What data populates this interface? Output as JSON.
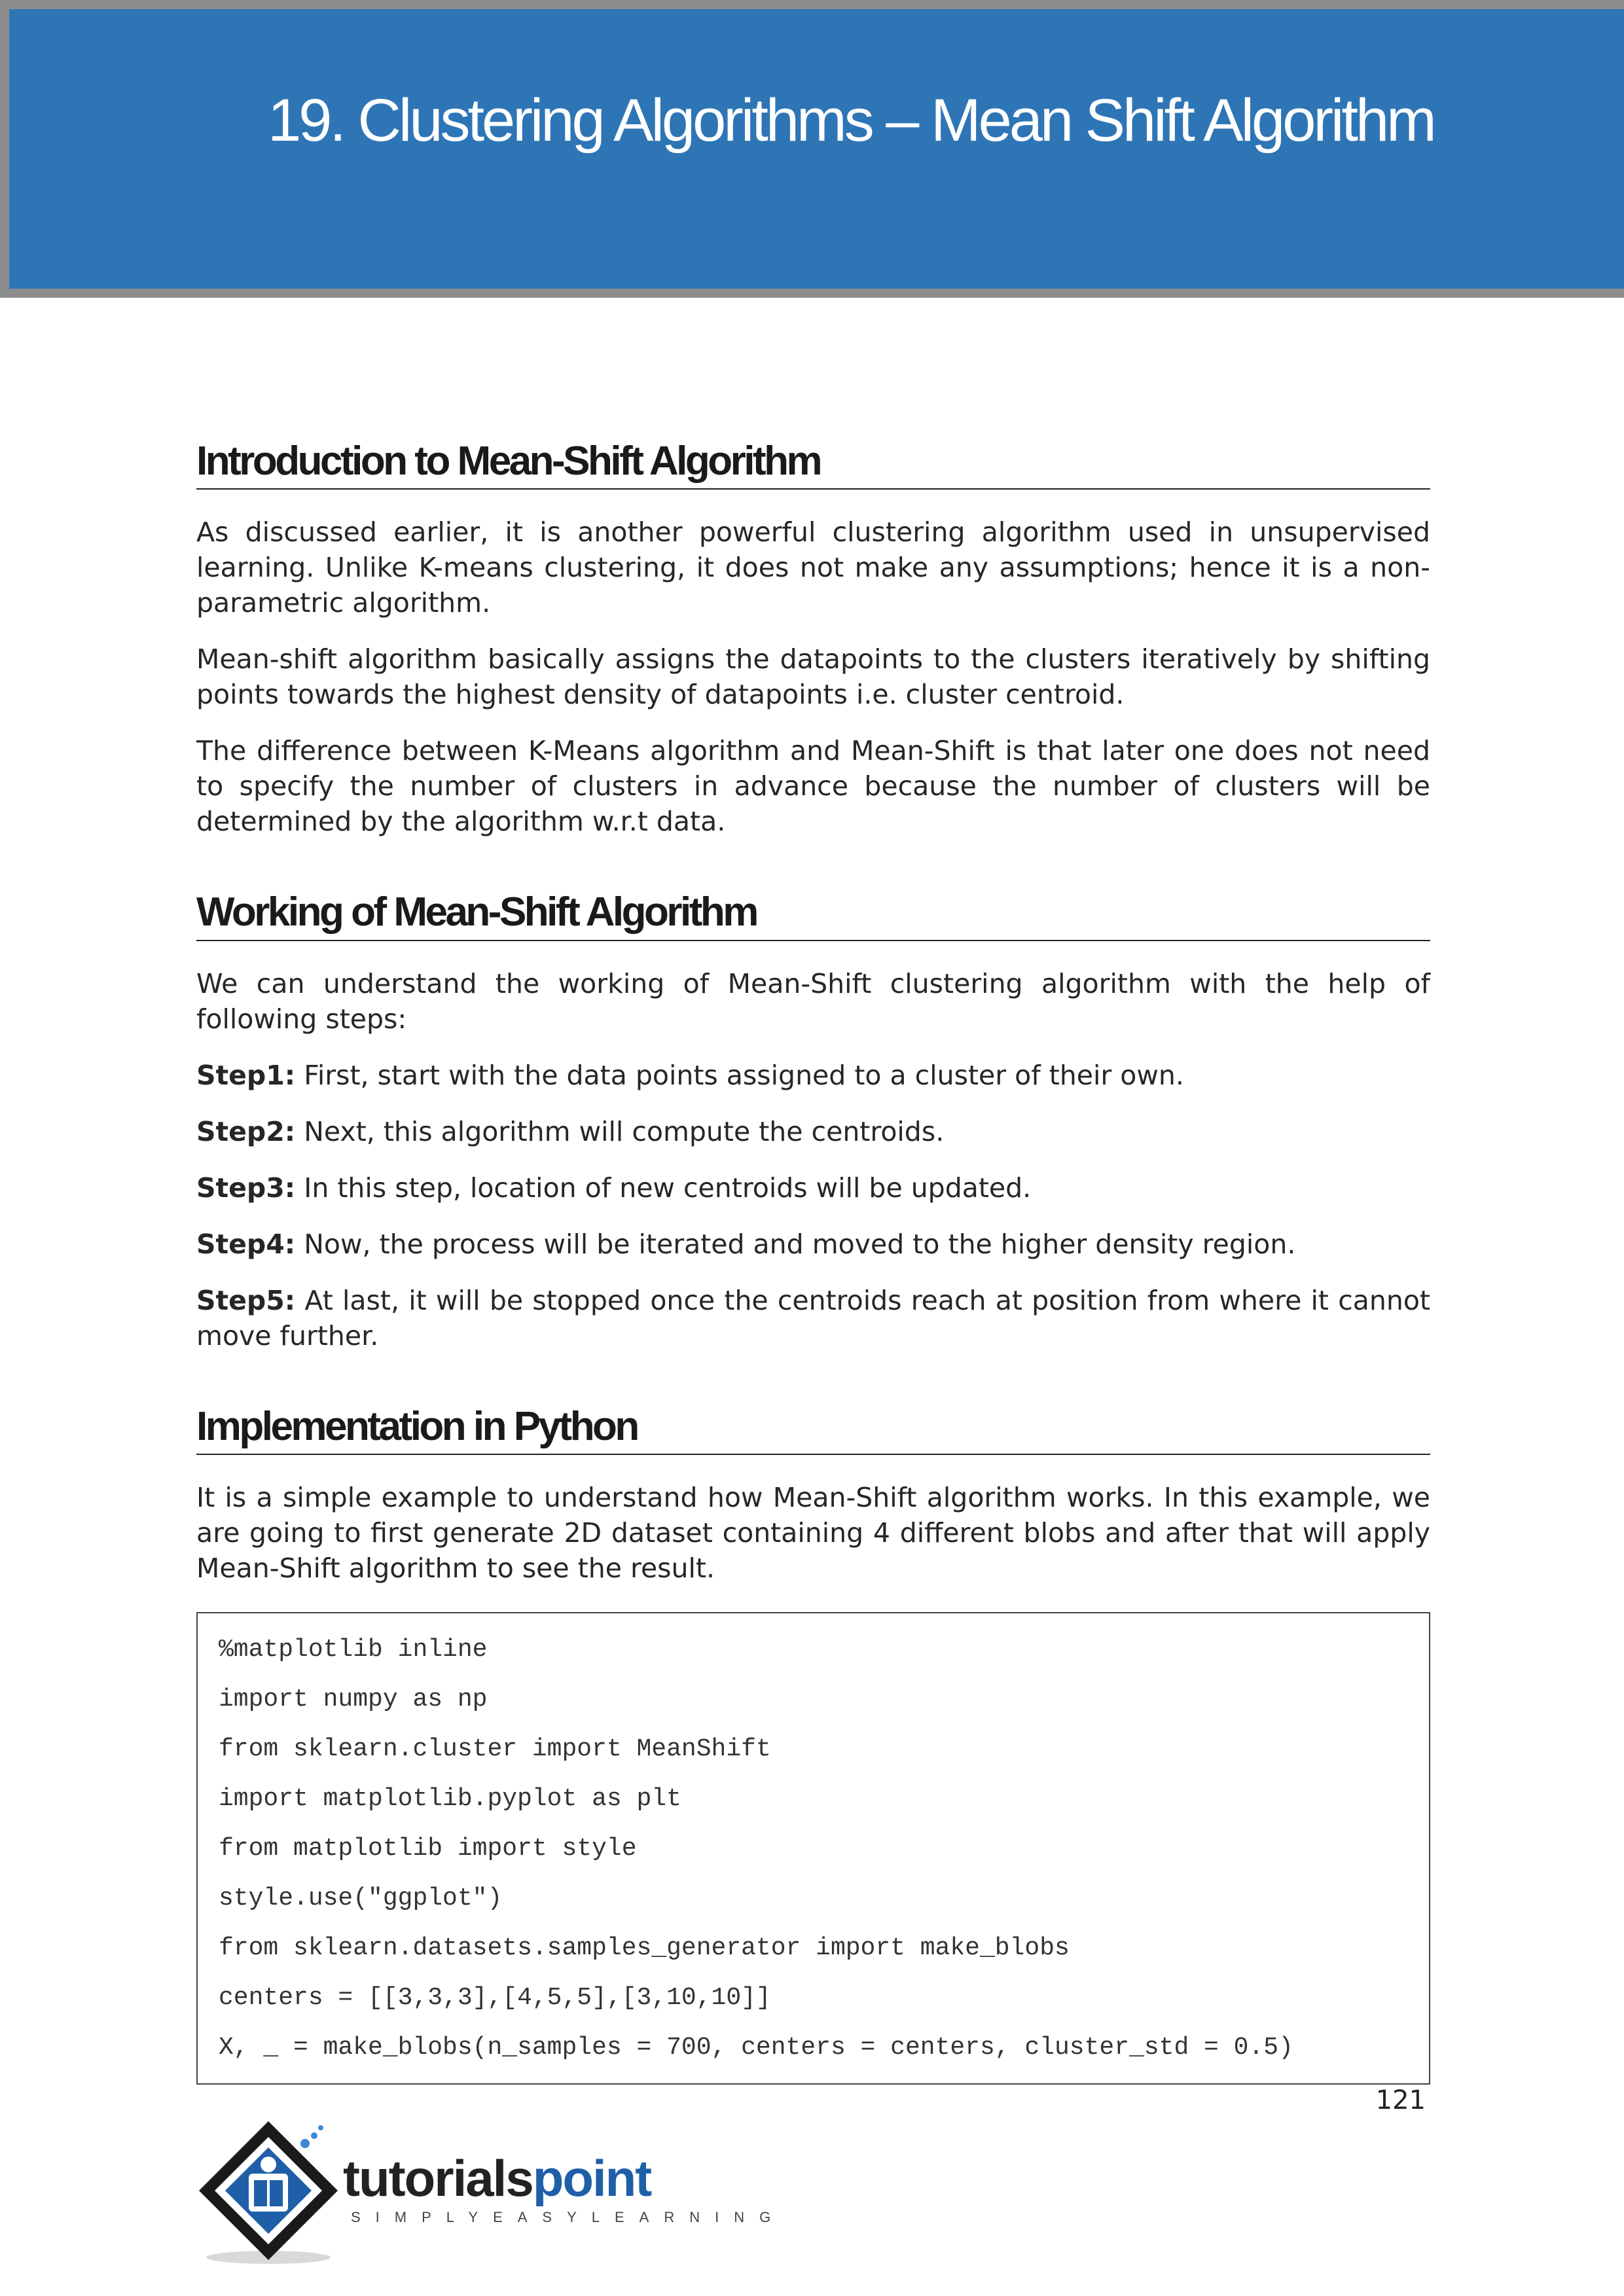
{
  "chapter": {
    "title": "19.  Clustering Algorithms – Mean Shift Algorithm"
  },
  "sections": [
    {
      "heading": "Introduction to Mean-Shift Algorithm",
      "paragraphs": [
        "As discussed earlier, it is another powerful clustering algorithm used in unsupervised learning. Unlike K-means clustering, it does not make any assumptions; hence it is a non-parametric algorithm.",
        "Mean-shift algorithm basically assigns the datapoints to the clusters iteratively by shifting points towards the highest density of datapoints i.e. cluster centroid.",
        "The difference between K-Means algorithm and Mean-Shift is that later one does not need to specify the number of clusters in advance because the number of clusters will be determined by the algorithm w.r.t data."
      ]
    },
    {
      "heading": "Working of Mean-Shift Algorithm",
      "intro": "We can understand the working of Mean-Shift clustering algorithm with the help of following steps:",
      "steps": [
        {
          "label": "Step1:",
          "text": " First, start with the data points assigned to a cluster of their own."
        },
        {
          "label": "Step2:",
          "text": " Next, this algorithm will compute the centroids."
        },
        {
          "label": "Step3:",
          "text": " In this step, location of new centroids will be updated."
        },
        {
          "label": "Step4:",
          "text": " Now, the process will be iterated and moved to the higher density region."
        },
        {
          "label": "Step5:",
          "text": " At last, it will be stopped once the centroids reach at position from where it cannot move further."
        }
      ]
    },
    {
      "heading": "Implementation in Python",
      "paragraphs": [
        "It is a simple example to understand how Mean-Shift algorithm works. In this example, we are going to first generate 2D dataset containing 4 different blobs and after that will apply Mean-Shift algorithm to see the result."
      ]
    }
  ],
  "code": {
    "lines": [
      "%matplotlib inline",
      "import numpy as np",
      "from sklearn.cluster import MeanShift",
      "import matplotlib.pyplot as plt",
      "from matplotlib import style",
      "style.use(\"ggplot\")",
      "from sklearn.datasets.samples_generator import make_blobs",
      "centers = [[3,3,3],[4,5,5],[3,10,10]]",
      "X, _ = make_blobs(n_samples = 700, centers = centers, cluster_std = 0.5)"
    ]
  },
  "footer": {
    "page_number": "121",
    "logo_word_1": "tutorials",
    "logo_word_2": "point",
    "logo_tagline": "SIMPLYEASYLEARNING"
  },
  "colors": {
    "banner": "#2e75b6",
    "banner_border": "#8d8d8d",
    "logo_blue": "#1f5fa8"
  }
}
